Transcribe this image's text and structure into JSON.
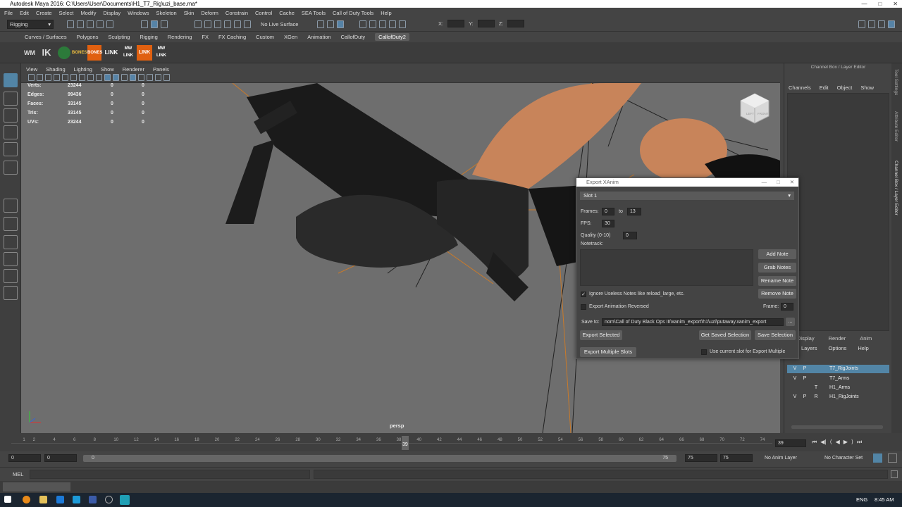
{
  "window": {
    "title": "Autodesk Maya 2016: C:\\Users\\User\\Documents\\H1_T7_Rig\\uzi_base.ma*"
  },
  "menubar": [
    "File",
    "Edit",
    "Create",
    "Select",
    "Modify",
    "Display",
    "Windows",
    "Skeleton",
    "Skin",
    "Deform",
    "Constrain",
    "Control",
    "Cache",
    "SEA Tools",
    "Call of Duty Tools",
    "Help"
  ],
  "status": {
    "mode": "Rigging",
    "live_surface": "No Live Surface",
    "x_label": "X:",
    "y_label": "Y:",
    "z_label": "Z:"
  },
  "shelf_tabs": [
    "Curves / Surfaces",
    "Polygons",
    "Sculpting",
    "Rigging",
    "Rendering",
    "FX",
    "FX Caching",
    "Custom",
    "XGen",
    "Animation",
    "CallofDuty",
    "CallofDuty2"
  ],
  "shelf_tab_selected": "CallofDuty2",
  "shelf_buttons": [
    "WM",
    "IK",
    "BONES",
    "BONES",
    "LINK",
    "MW LINK",
    "LINK",
    "MW LINK"
  ],
  "viewport_menu": [
    "View",
    "Shading",
    "Lighting",
    "Show",
    "Renderer",
    "Panels"
  ],
  "hud": [
    {
      "label": "Verts:",
      "v1": "23244",
      "v2": "0",
      "v3": "0"
    },
    {
      "label": "Edges:",
      "v1": "99436",
      "v2": "0",
      "v3": "0"
    },
    {
      "label": "Faces:",
      "v1": "33145",
      "v2": "0",
      "v3": "0"
    },
    {
      "label": "Tris:",
      "v1": "33145",
      "v2": "0",
      "v3": "0"
    },
    {
      "label": "UVs:",
      "v1": "23244",
      "v2": "0",
      "v3": "0"
    }
  ],
  "viewport_camera": "persp",
  "viewcube": {
    "left": "LEFT",
    "front": "FRONT"
  },
  "channel_box": {
    "title": "Channel Box / Layer Editor",
    "menu": [
      "Channels",
      "Edit",
      "Object",
      "Show"
    ],
    "layer_tabs": [
      "Display",
      "Render",
      "Anim"
    ],
    "layer_menu": [
      "Layers",
      "Options",
      "Help"
    ],
    "layers": [
      {
        "v": "V",
        "p": "P",
        "t": "",
        "name": "T7_RigJoints",
        "selected": true
      },
      {
        "v": "V",
        "p": "P",
        "t": "",
        "name": "T7_Arms",
        "selected": false
      },
      {
        "v": "",
        "p": "",
        "t": "T",
        "name": "H1_Arms",
        "selected": false
      },
      {
        "v": "V",
        "p": "P",
        "t": "R",
        "name": "H1_RigJoints",
        "selected": false
      }
    ]
  },
  "side_tabs": [
    "Tool Settings",
    "Attribute Editor",
    "Channel Box / Layer Editor"
  ],
  "export_dialog": {
    "title": "Export XAnim",
    "slot": "Slot 1",
    "frames_label": "Frames:",
    "frame_start": "0",
    "to_label": "to",
    "frame_end": "13",
    "fps_label": "FPS:",
    "fps": "30",
    "quality_label": "Quality (0-10)",
    "quality": "0",
    "notetrack_label": "Notetrack:",
    "buttons": {
      "add_note": "Add Note",
      "grab_notes": "Grab Notes",
      "rename_note": "Rename Note",
      "remove_note": "Remove Note"
    },
    "ignore_useless": "Ignore Useless Notes like reload_large, etc.",
    "ignore_checked": true,
    "export_reversed": "Export Animation Reversed",
    "reversed_checked": false,
    "frame_label": "Frame:",
    "frame_value": "0",
    "save_to_label": "Save to:",
    "save_to_path": "nom\\Call of Duty Black Ops III\\xanim_export\\h1\\uzi\\putaway.xanim_export",
    "browse": "...",
    "export_selected": "Export Selected",
    "get_saved_selection": "Get Saved Selection",
    "save_selection": "Save Selection",
    "export_multiple": "Export Multiple Slots",
    "use_current_slot": "Use current slot for Export Multiple"
  },
  "timeline": {
    "ticks": [
      "1",
      "2",
      "4",
      "6",
      "8",
      "10",
      "12",
      "14",
      "16",
      "18",
      "20",
      "22",
      "24",
      "26",
      "28",
      "30",
      "32",
      "34",
      "36",
      "38",
      "40",
      "42",
      "44",
      "46",
      "48",
      "50",
      "52",
      "54",
      "56",
      "58",
      "60",
      "62",
      "64",
      "66",
      "68",
      "70",
      "72",
      "74"
    ],
    "current_frame": "39",
    "current_frame_field": "39"
  },
  "range": {
    "start": "0",
    "inner_start": "0",
    "range_start_label": "0",
    "range_end_label": "75",
    "end": "75",
    "anim_end": "75",
    "anim_layer": "No Anim Layer",
    "character_set": "No Character Set"
  },
  "command": {
    "lang": "MEL"
  },
  "taskbar": {
    "time": "8:45 AM",
    "lang": "ENG"
  }
}
